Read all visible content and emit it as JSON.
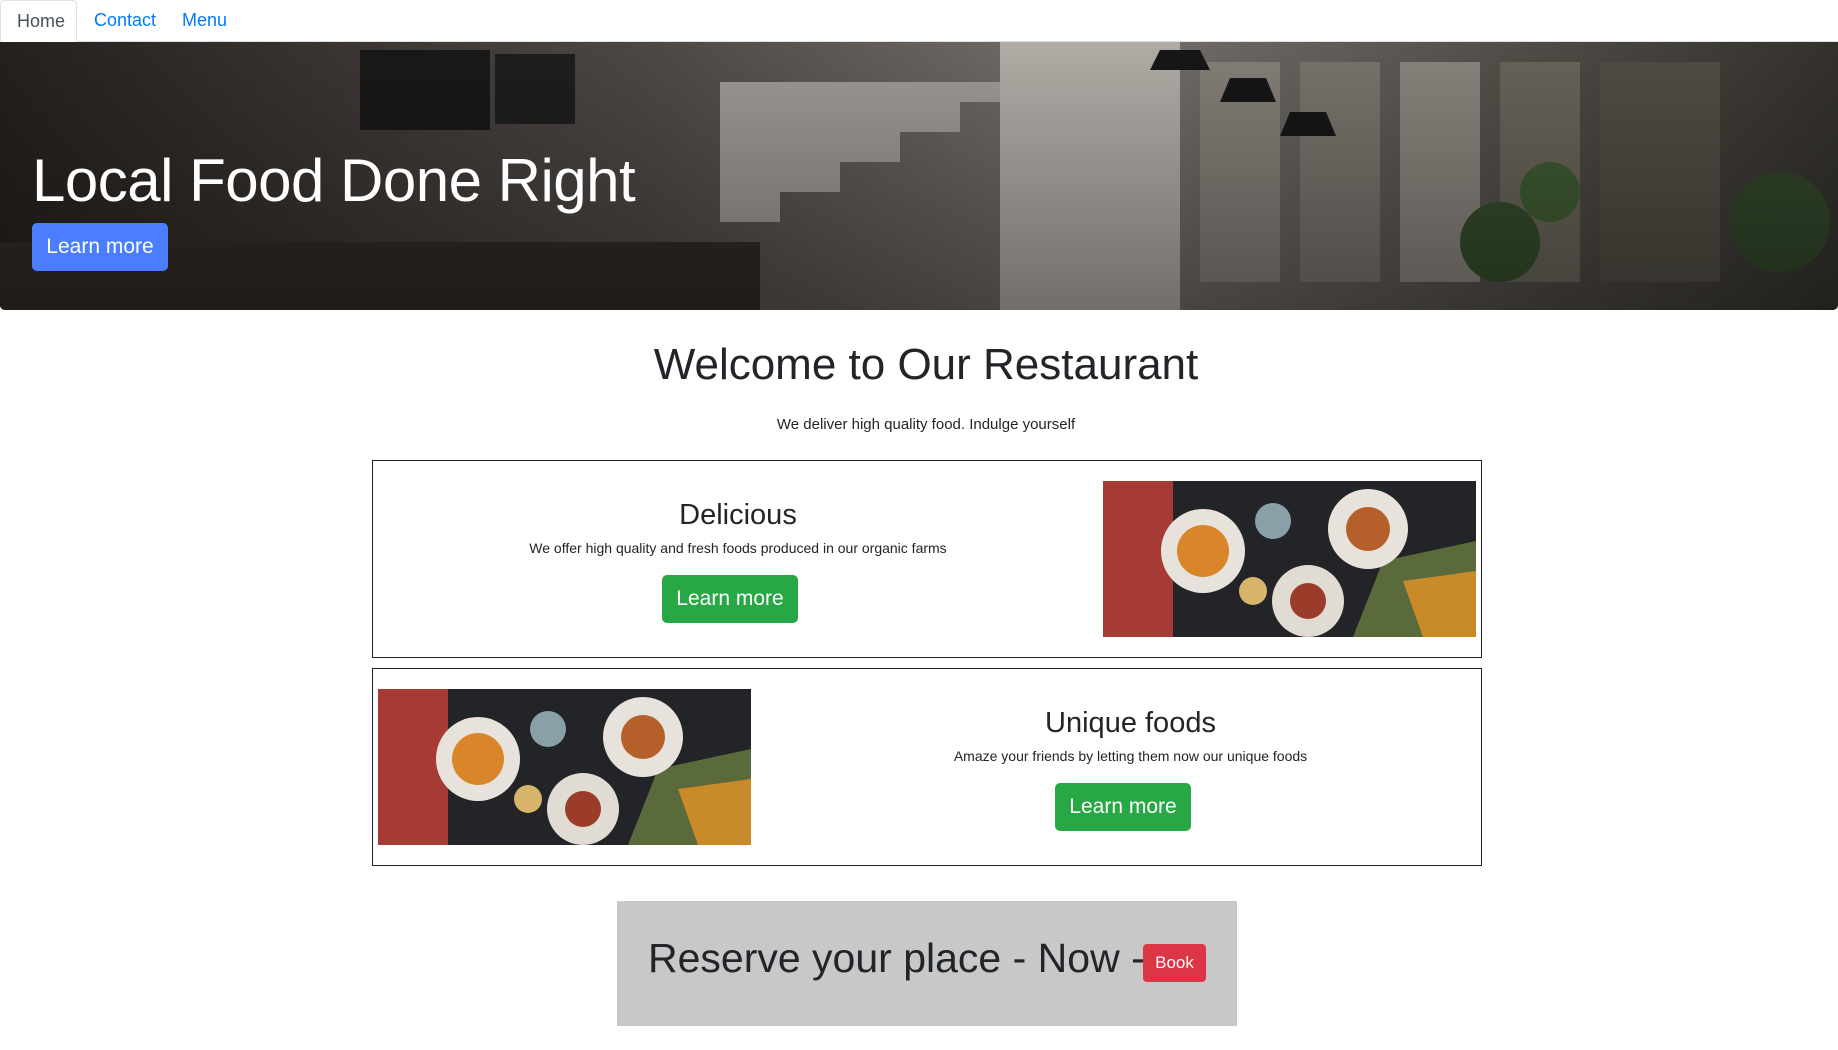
{
  "nav": {
    "tabs": [
      {
        "label": "Home",
        "active": true
      },
      {
        "label": "Contact",
        "active": false
      },
      {
        "label": "Menu",
        "active": false
      }
    ]
  },
  "hero": {
    "title": "Local Food Done Right",
    "button_label": "Learn more",
    "image": "restaurant-interior-photo"
  },
  "welcome": {
    "title": "Welcome to Our Restaurant",
    "subtitle": "We deliver high quality food. Indulge yourself"
  },
  "features": [
    {
      "heading": "Delicious",
      "text": "We offer high quality and fresh foods produced in our organic farms",
      "button_label": "Learn more",
      "image": "food-table-photo"
    },
    {
      "heading": "Unique foods",
      "text": "Amaze your friends by letting them now our unique foods",
      "button_label": "Learn more",
      "image": "food-table-photo"
    }
  ],
  "reserve": {
    "text": "Reserve your place - Now -",
    "button_label": "Book"
  },
  "colors": {
    "link": "#007bff",
    "primary": "#4a7dff",
    "success": "#28a745",
    "danger": "#dc3545",
    "reserve_bg": "#c8c8c8"
  }
}
